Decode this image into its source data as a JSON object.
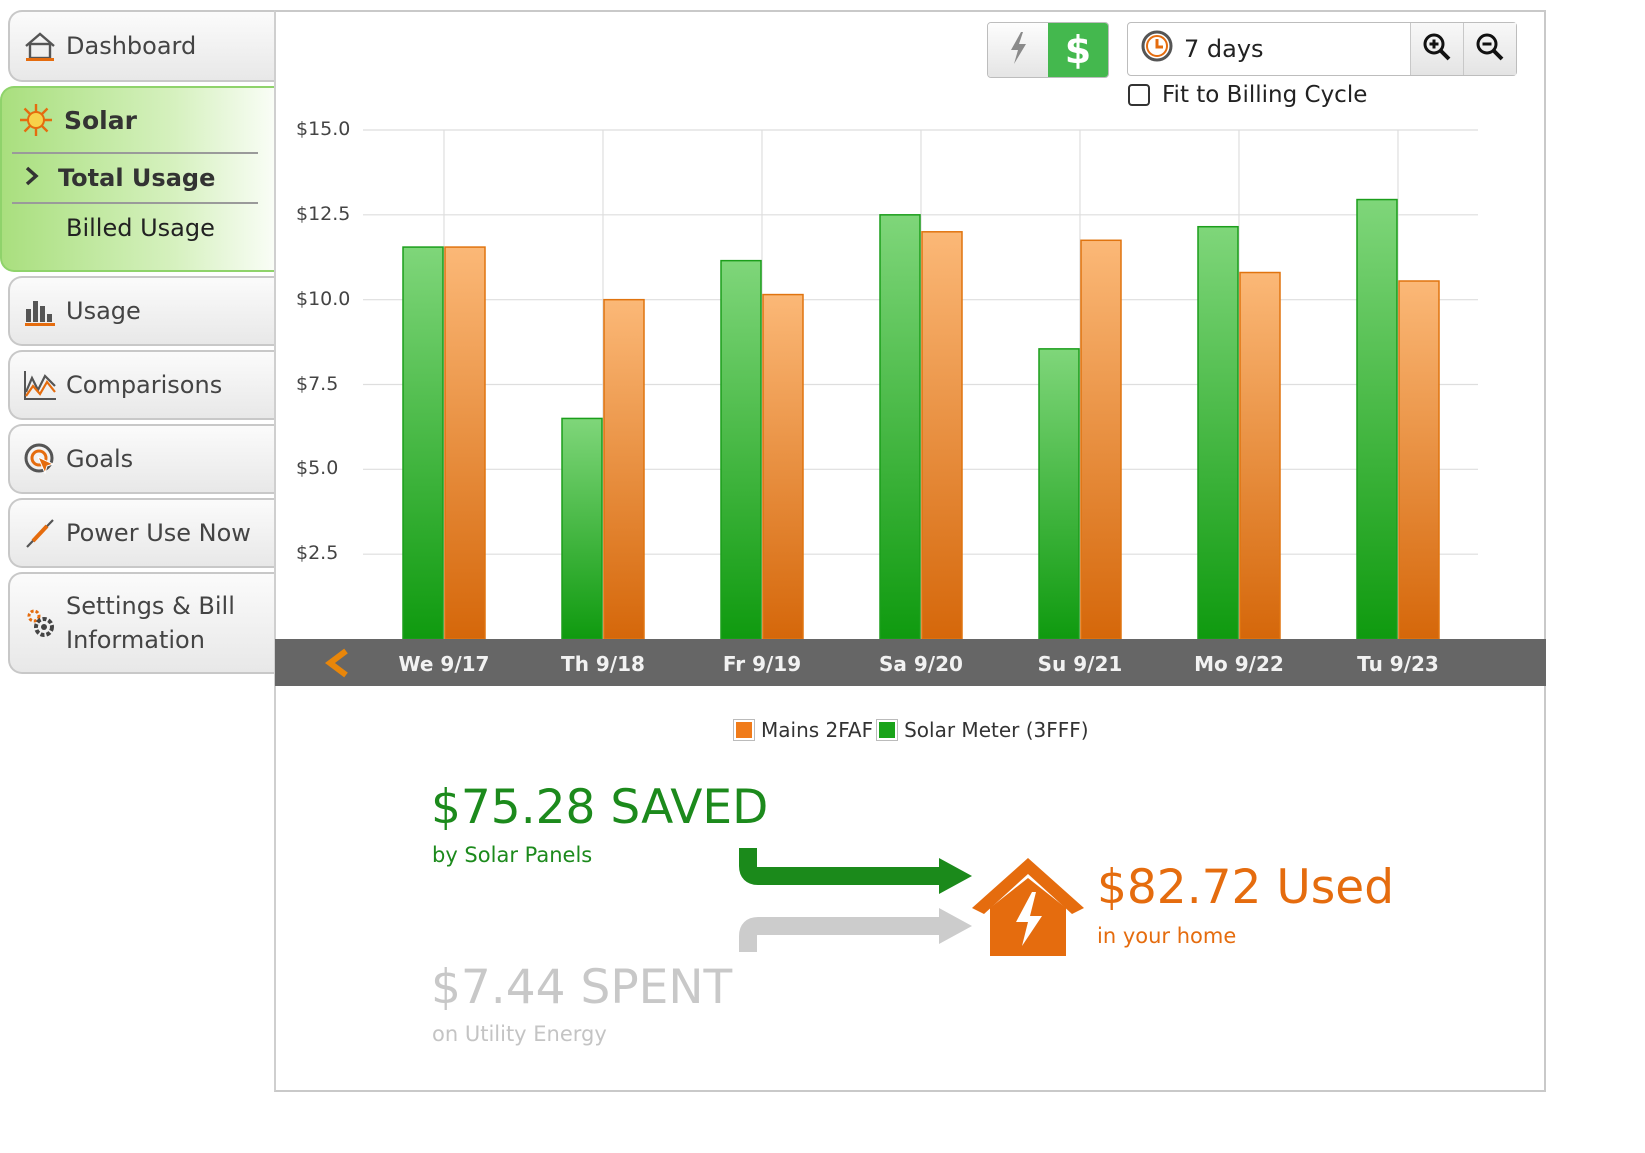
{
  "sidebar": {
    "dashboard": "Dashboard",
    "solar": "Solar",
    "solar_sub": {
      "total_usage": "Total Usage",
      "billed_usage": "Billed Usage"
    },
    "usage": "Usage",
    "comparisons": "Comparisons",
    "goals": "Goals",
    "power_use_now": "Power Use Now",
    "settings_line1": "Settings & Bill",
    "settings_line2": "Information"
  },
  "toolbar": {
    "cost_symbol": "$",
    "range_label": "7 days",
    "fit_billing": "Fit to Billing Cycle",
    "fit_billing_checked": false
  },
  "colors": {
    "solar": "#1fae1f",
    "mains": "#f28a2a",
    "accent_green": "#44b84e",
    "accent_orange": "#e56c0e"
  },
  "chart_data": {
    "type": "bar",
    "categories": [
      "We 9/17",
      "Th 9/18",
      "Fr 9/19",
      "Sa 9/20",
      "Su 9/21",
      "Mo 9/22",
      "Tu 9/23"
    ],
    "series": [
      {
        "name": "Solar Meter (3FFF)",
        "values": [
          11.55,
          6.5,
          11.15,
          12.5,
          8.55,
          12.15,
          12.95
        ]
      },
      {
        "name": "Mains 2FAF",
        "values": [
          11.55,
          10.0,
          10.15,
          12.0,
          11.75,
          10.8,
          10.55
        ]
      }
    ],
    "yticks": [
      "$2.5",
      "$5.0",
      "$7.5",
      "$10.0",
      "$12.5",
      "$15.0"
    ],
    "ylim": [
      0,
      15
    ],
    "legend": [
      "Mains 2FAF",
      "Solar Meter (3FFF)"
    ]
  },
  "summary": {
    "saved": "$75.28 SAVED",
    "saved_sub": "by Solar Panels",
    "spent": "$7.44 SPENT",
    "spent_sub": "on Utility Energy",
    "used": "$82.72 Used",
    "used_sub": "in your home"
  }
}
